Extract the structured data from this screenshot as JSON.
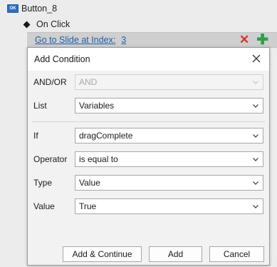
{
  "tree": {
    "object_icon": "OK",
    "object_name": "Button_8",
    "event_label": "On Click",
    "action_link": "Go to Slide at Index:",
    "action_value": "3",
    "delete_icon": "delete-x-icon",
    "add_icon": "add-plus-icon"
  },
  "dialog": {
    "title": "Add Condition",
    "fields": {
      "andor": {
        "label": "AND/OR",
        "value": "AND"
      },
      "list": {
        "label": "List",
        "value": "Variables"
      },
      "if": {
        "label": "If",
        "value": "dragComplete"
      },
      "operator": {
        "label": "Operator",
        "value": "is equal to"
      },
      "type": {
        "label": "Type",
        "value": "Value"
      },
      "value": {
        "label": "Value",
        "value": "True"
      }
    },
    "buttons": {
      "add_continue": "Add & Continue",
      "add": "Add",
      "cancel": "Cancel"
    }
  },
  "colors": {
    "link": "#1f5fa8",
    "delete": "#d6322c",
    "add": "#2ba14a"
  }
}
